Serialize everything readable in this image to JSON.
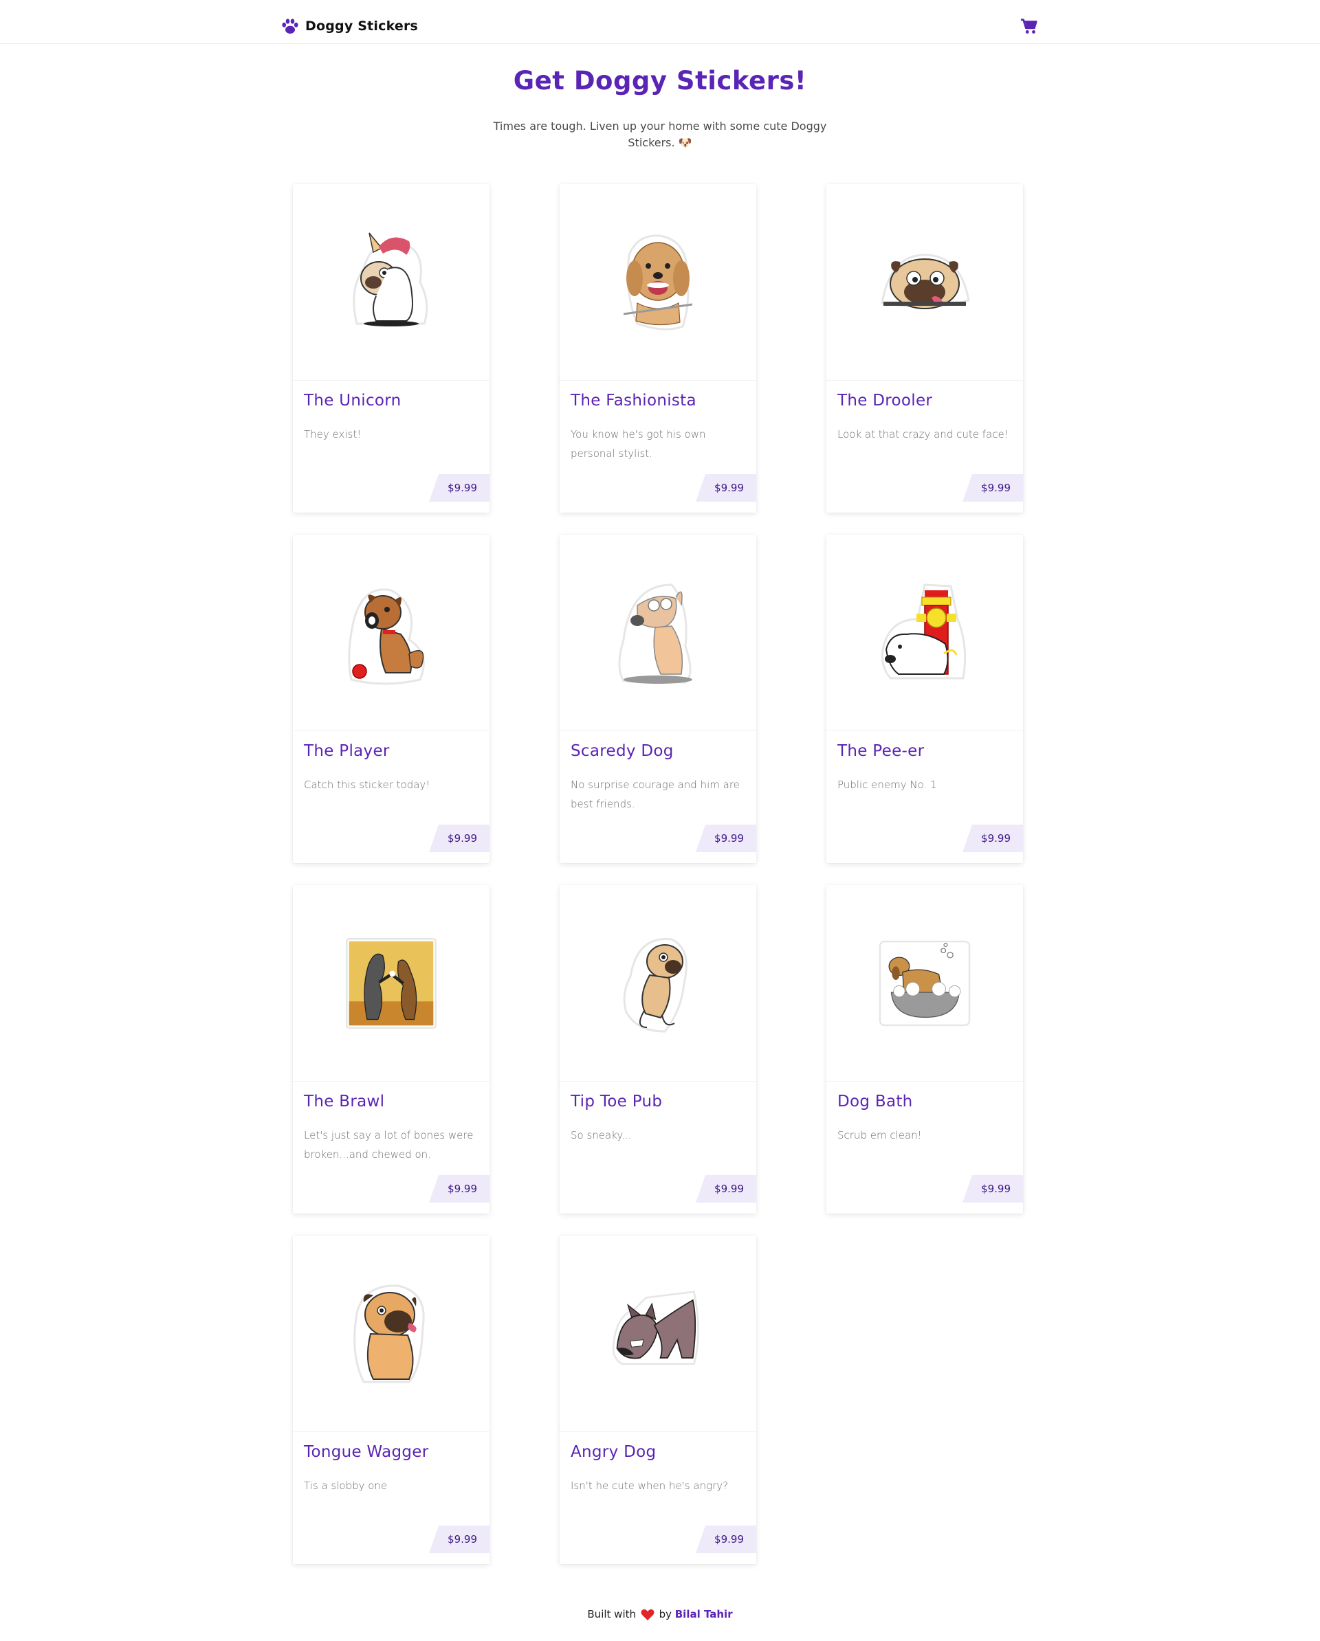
{
  "brand": {
    "name": "Doggy Stickers",
    "icon": "paw-icon"
  },
  "cart": {
    "icon": "shopping-cart-icon"
  },
  "hero": {
    "title": "Get Doggy Stickers!",
    "subtitle": "Times are tough. Liven up your home with some cute Doggy Stickers. 🐶"
  },
  "products": [
    {
      "title": "The Unicorn",
      "description": "They exist!",
      "price": "$9.99",
      "image": "unicorn-pug-sticker"
    },
    {
      "title": "The Fashionista",
      "description": "You know he's got his own personal stylist.",
      "price": "$9.99",
      "image": "fluffy-dog-sticker"
    },
    {
      "title": "The Drooler",
      "description": "Look at that crazy and cute face!",
      "price": "$9.99",
      "image": "pug-face-sticker"
    },
    {
      "title": "The Player",
      "description": "Catch this sticker today!",
      "price": "$9.99",
      "image": "puppy-ball-sticker"
    },
    {
      "title": "Scaredy Dog",
      "description": "No surprise courage and him are best friends.",
      "price": "$9.99",
      "image": "scared-dog-sticker"
    },
    {
      "title": "The Pee-er",
      "description": "Public enemy No. 1",
      "price": "$9.99",
      "image": "dog-hydrant-sticker"
    },
    {
      "title": "The Brawl",
      "description": "Let's just say a lot of bones were broken...and chewed on.",
      "price": "$9.99",
      "image": "dogs-boxing-sticker"
    },
    {
      "title": "Tip Toe Pub",
      "description": "So sneaky...",
      "price": "$9.99",
      "image": "tiptoe-pug-sticker"
    },
    {
      "title": "Dog Bath",
      "description": "Scrub em clean!",
      "price": "$9.99",
      "image": "dog-bath-sticker"
    },
    {
      "title": "Tongue Wagger",
      "description": "Tis a slobby one",
      "price": "$9.99",
      "image": "sitting-pug-sticker"
    },
    {
      "title": "Angry Dog",
      "description": "Isn't he cute when he's angry?",
      "price": "$9.99",
      "image": "angry-dog-sticker"
    }
  ],
  "footer": {
    "prefix": "Built with",
    "heart_icon": "heart-icon",
    "by": "by",
    "author": "Bilal Tahir"
  },
  "colors": {
    "accent": "#5a24b4",
    "price_bg": "#efeaf9",
    "heart": "#e0262c"
  }
}
